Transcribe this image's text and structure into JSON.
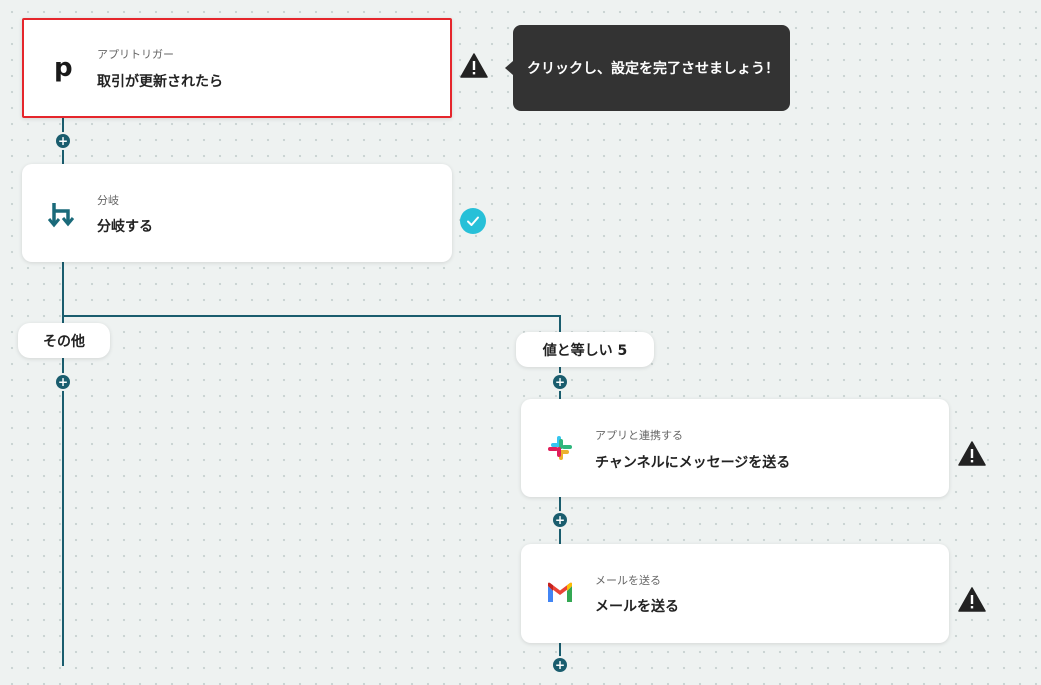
{
  "flow": {
    "trigger": {
      "category": "アプリトリガー",
      "title": "取引が更新されたら",
      "app_icon": "pipedrive-p-icon",
      "status": "warning"
    },
    "tooltip": "クリックし、設定を完了させましょう！",
    "branch": {
      "category": "分岐",
      "title": "分岐する",
      "icon": "branch-icon",
      "status": "completed"
    },
    "branch_labels": {
      "other": "その他",
      "equals": "値と等しい 5"
    },
    "slack_step": {
      "category": "アプリと連携する",
      "title": "チャンネルにメッセージを送る",
      "app_icon": "slack-icon",
      "status": "warning"
    },
    "gmail_step": {
      "category": "メールを送る",
      "title": "メールを送る",
      "app_icon": "gmail-icon",
      "status": "warning"
    },
    "add_step_symbol": "+"
  },
  "colors": {
    "line": "#1a5d6e",
    "selected_border": "#e5262c",
    "tooltip_bg": "#333333",
    "check": "#27c0d8",
    "background": "#eef2f1"
  }
}
